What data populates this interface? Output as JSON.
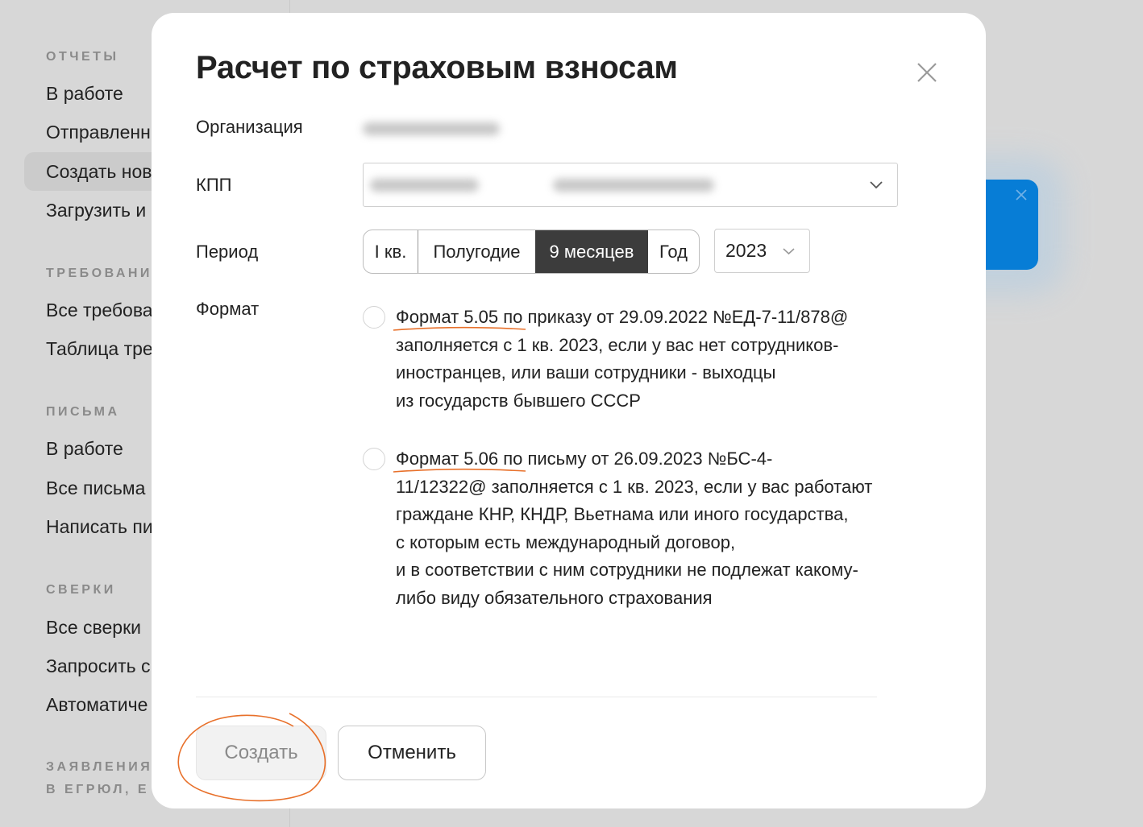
{
  "sidebar": {
    "sections": [
      {
        "title": "ОТЧЕТЫ",
        "items": [
          "В работе",
          "Отправленн",
          "Создать нов",
          "Загрузить и"
        ]
      },
      {
        "title": "ТРЕБОВАНИ",
        "items": [
          "Все требова",
          "Таблица тре"
        ]
      },
      {
        "title": "ПИСЬМА",
        "items": [
          "В работе",
          "Все письма",
          "Написать пи"
        ]
      },
      {
        "title": "СВЕРКИ",
        "items": [
          "Все сверки",
          "Запросить с",
          "Автоматиче"
        ]
      },
      {
        "title_lines": [
          "ЗАЯВЛЕНИЯ",
          "В ЕГРЮЛ, Е"
        ]
      }
    ],
    "active_item": "Создать нов"
  },
  "modal": {
    "title": "Расчет по страховым взносам",
    "close_icon": "close-icon",
    "fields": {
      "organization_label": "Организация",
      "kpp_label": "КПП",
      "period_label": "Период",
      "format_label": "Формат"
    },
    "period_options": [
      "I кв.",
      "Полугодие",
      "9 месяцев",
      "Год"
    ],
    "period_selected": "9 месяцев",
    "year_selected": "2023",
    "format_options": [
      {
        "selected": false,
        "lines": [
          "Формат 5.05 по приказу от 29.09.2022 №ЕД-7-11/878@",
          "заполняется с 1 кв. 2023, если у вас нет сотрудников-",
          "иностранцев, или ваши сотрудники - выходцы",
          "из государств бывшего СССР"
        ]
      },
      {
        "selected": false,
        "lines": [
          "Формат 5.06 по письму от 26.09.2023 №БС-4-",
          "11/12322@ заполняется с 1 кв. 2023, если у вас работают",
          "граждане КНР, КНДР, Вьетнама или иного государства,",
          "с которым есть международный договор,",
          "и в соответствии с ним сотрудники не подлежат какому-",
          "либо виду обязательного страхования"
        ]
      }
    ],
    "buttons": {
      "create": "Создать",
      "cancel": "Отменить"
    }
  },
  "colors": {
    "annotation": "#e8702a",
    "toast": "#077dd6",
    "active_segment": "#3c3c3c"
  }
}
